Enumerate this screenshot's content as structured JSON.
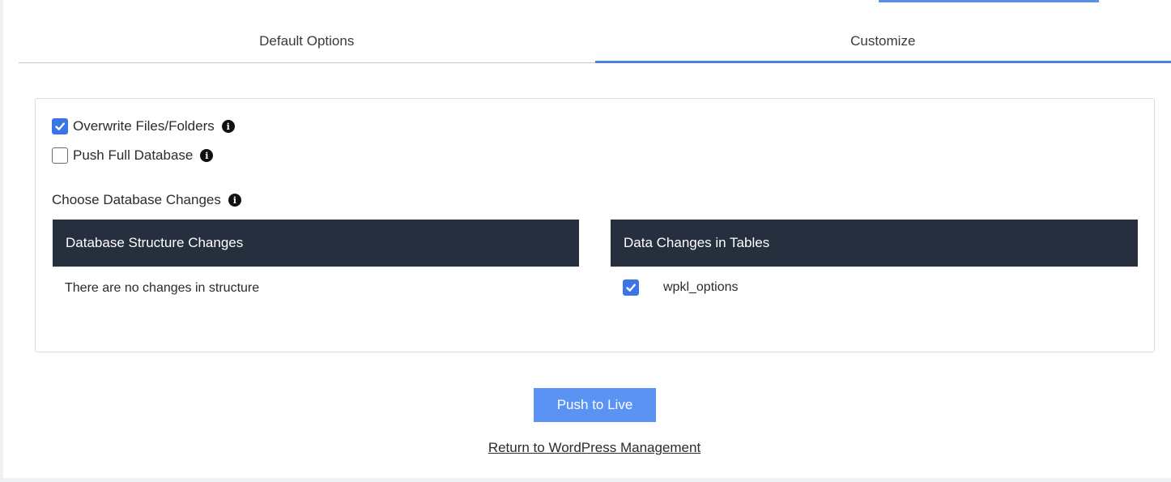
{
  "tabs": [
    {
      "label": "Default Options",
      "active": false
    },
    {
      "label": "Customize",
      "active": true
    }
  ],
  "options": {
    "overwrite_files": {
      "label": "Overwrite Files/Folders",
      "checked": true
    },
    "push_full_database": {
      "label": "Push Full Database",
      "checked": false
    }
  },
  "db_changes": {
    "label": "Choose Database Changes",
    "structure_header": "Database Structure Changes",
    "structure_empty": "There are no changes in structure",
    "data_header": "Data Changes in Tables",
    "tables": [
      {
        "name": "wpkl_options",
        "checked": true
      }
    ]
  },
  "actions": {
    "push_label": "Push to Live",
    "return_label": "Return to WordPress Management"
  },
  "colors": {
    "accent": "#4f7fe0",
    "button": "#5b93f5",
    "table_header": "#252f3d",
    "checkbox": "#3b74e6"
  },
  "icons": {
    "info": "info-icon",
    "check": "checkmark-icon"
  }
}
